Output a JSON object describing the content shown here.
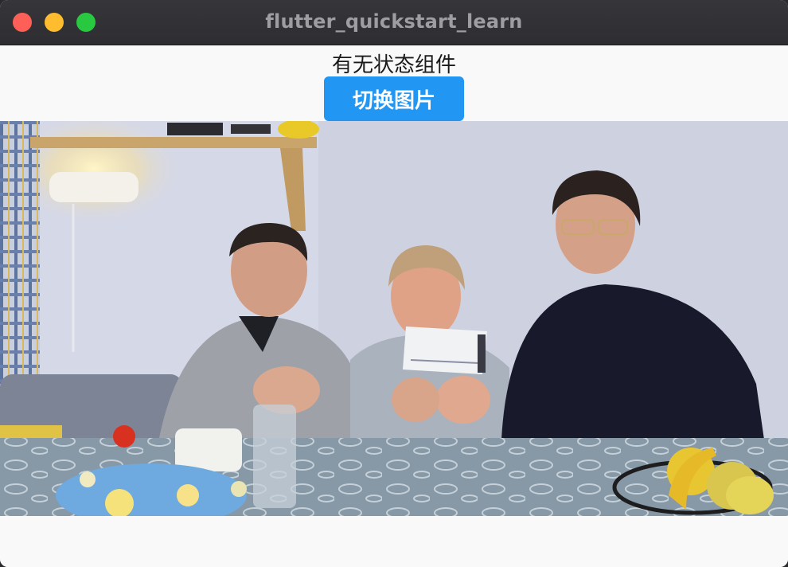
{
  "window": {
    "title": "flutter_quickstart_learn"
  },
  "page": {
    "heading": "有无状态组件",
    "toggle_button_label": "切换图片"
  },
  "photo": {
    "subject": "three-people-holding-cheque-photo"
  }
}
